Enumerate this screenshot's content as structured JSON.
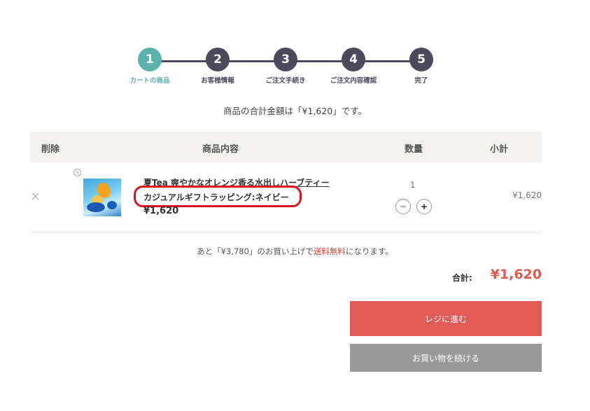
{
  "steps": [
    {
      "num": "1",
      "label": "カートの商品"
    },
    {
      "num": "2",
      "label": "お客様情報"
    },
    {
      "num": "3",
      "label": "ご注文手続き"
    },
    {
      "num": "4",
      "label": "ご注文内容確認"
    },
    {
      "num": "5",
      "label": "完了"
    }
  ],
  "total_message": "商品の合計金額は「¥1,620」です。",
  "table": {
    "headers": {
      "delete": "削除",
      "content": "商品内容",
      "quantity": "数量",
      "subtotal": "小計"
    },
    "item": {
      "delete_icon": "×",
      "name": "夏Tea 爽やかなオレンジ香る水出しハーブティー",
      "option": "カジュアルギフトラッピング:ネイビー",
      "price": "¥1,620",
      "quantity": "1",
      "minus": "−",
      "plus": "+",
      "subtotal": "¥1,620"
    }
  },
  "shipping": {
    "prefix": "あと「¥3,780」のお買い上げで",
    "highlight": "送料無料",
    "suffix": "になります。"
  },
  "summary": {
    "label": "合計:",
    "value": "¥1,620"
  },
  "buttons": {
    "checkout": "レジに進む",
    "continue": "お買い物を続ける"
  },
  "colors": {
    "accent_teal": "#5bb2ad",
    "step_dark": "#4b4a5c",
    "checkout": "#e15b57",
    "highlight_red": "#d8121f"
  }
}
